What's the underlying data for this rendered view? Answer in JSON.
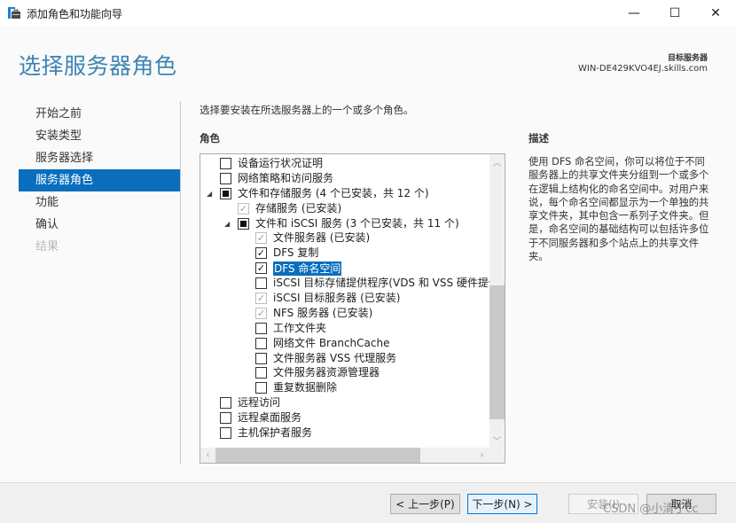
{
  "window": {
    "title": "添加角色和功能向导",
    "minimize_glyph": "—",
    "maximize_glyph": "☐",
    "close_glyph": "✕"
  },
  "header": {
    "page_title": "选择服务器角色",
    "target_label": "目标服务器",
    "target_server": "WIN-DE429KVO4EJ.skills.com"
  },
  "nav": {
    "items": [
      {
        "label": "开始之前",
        "state": "normal"
      },
      {
        "label": "安装类型",
        "state": "normal"
      },
      {
        "label": "服务器选择",
        "state": "normal"
      },
      {
        "label": "服务器角色",
        "state": "active"
      },
      {
        "label": "功能",
        "state": "normal"
      },
      {
        "label": "确认",
        "state": "normal"
      },
      {
        "label": "结果",
        "state": "disabled"
      }
    ]
  },
  "main": {
    "instruction": "选择要安装在所选服务器上的一个或多个角色。",
    "roles_heading": "角色",
    "roles": [
      {
        "label": "设备运行状况证明",
        "level": 0,
        "state": "unchecked",
        "expander": null
      },
      {
        "label": "网络策略和访问服务",
        "level": 0,
        "state": "unchecked",
        "expander": null
      },
      {
        "label": "文件和存储服务 (4 个已安装，共 12 个)",
        "level": 0,
        "state": "partial",
        "expander": "expanded"
      },
      {
        "label": "存储服务 (已安装)",
        "level": 1,
        "state": "installed",
        "expander": null
      },
      {
        "label": "文件和 iSCSI 服务 (3 个已安装，共 11 个)",
        "level": 1,
        "state": "partial",
        "expander": "expanded"
      },
      {
        "label": "文件服务器 (已安装)",
        "level": 2,
        "state": "installed",
        "expander": null
      },
      {
        "label": "DFS 复制",
        "level": 2,
        "state": "checked",
        "expander": null
      },
      {
        "label": "DFS 命名空间",
        "level": 2,
        "state": "checked",
        "expander": null,
        "selected": true
      },
      {
        "label": "iSCSI 目标存储提供程序(VDS 和 VSS 硬件提供程序)",
        "level": 2,
        "state": "unchecked",
        "expander": null
      },
      {
        "label": "iSCSI 目标服务器 (已安装)",
        "level": 2,
        "state": "installed",
        "expander": null
      },
      {
        "label": "NFS 服务器 (已安装)",
        "level": 2,
        "state": "installed",
        "expander": null
      },
      {
        "label": "工作文件夹",
        "level": 2,
        "state": "unchecked",
        "expander": null
      },
      {
        "label": "网络文件 BranchCache",
        "level": 2,
        "state": "unchecked",
        "expander": null
      },
      {
        "label": "文件服务器 VSS 代理服务",
        "level": 2,
        "state": "unchecked",
        "expander": null
      },
      {
        "label": "文件服务器资源管理器",
        "level": 2,
        "state": "unchecked",
        "expander": null
      },
      {
        "label": "重复数据删除",
        "level": 2,
        "state": "unchecked",
        "expander": null
      },
      {
        "label": "远程访问",
        "level": 0,
        "state": "unchecked",
        "expander": null
      },
      {
        "label": "远程桌面服务",
        "level": 0,
        "state": "unchecked",
        "expander": null
      },
      {
        "label": "主机保护者服务",
        "level": 0,
        "state": "unchecked",
        "expander": null
      }
    ],
    "vscroll": {
      "thumb_start_fraction": 0.44,
      "thumb_end_fraction": 0.95
    },
    "hscroll": {
      "thumb_start_fraction": 0.0,
      "thumb_end_fraction": 0.79
    }
  },
  "description": {
    "heading": "描述",
    "text": "使用 DFS 命名空间，你可以将位于不同服务器上的共享文件夹分组到一个或多个在逻辑上结构化的命名空间中。对用户来说，每个命名空间都显示为一个单独的共享文件夹，其中包含一系列子文件夹。但是，命名空间的基础结构可以包括许多位于不同服务器和多个站点上的共享文件夹。"
  },
  "footer": {
    "prev_label": "< 上一步(P)",
    "next_label": "下一步(N) >",
    "install_label": "安装(I)",
    "cancel_label": "取消"
  },
  "watermark": "CSDN @小清丁cc",
  "colors": {
    "accent": "#0a6ebd",
    "title": "#3e84b4",
    "installed_check": "#9a9a9a"
  }
}
